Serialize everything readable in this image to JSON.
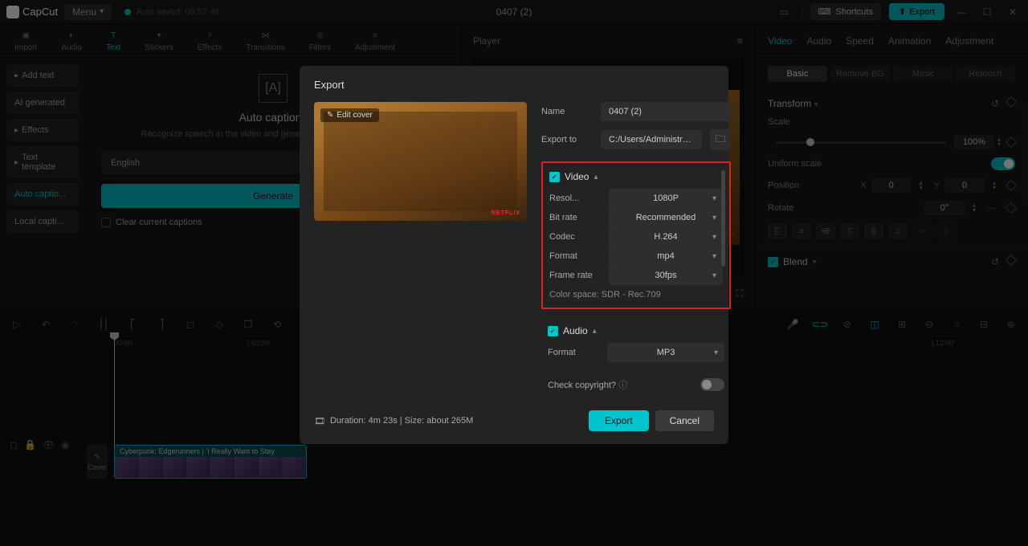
{
  "app": {
    "name": "CapCut",
    "menu": "Menu",
    "autosave": "Auto saved: 09:57:48",
    "title": "0407 (2)",
    "shortcuts": "Shortcuts",
    "export": "Export"
  },
  "tools": {
    "import": "Import",
    "audio": "Audio",
    "text": "Text",
    "stickers": "Stickers",
    "effects": "Effects",
    "transitions": "Transitions",
    "filters": "Filters",
    "adjustment": "Adjustment"
  },
  "sidebar": {
    "add_text": "Add text",
    "ai_generated": "AI generated",
    "effects": "Effects",
    "text_template": "Text template",
    "auto_captions": "Auto captio...",
    "local_captions": "Local capti..."
  },
  "auto_caption": {
    "title": "Auto captions",
    "desc": "Recognize speech in the video and generate captions automatically",
    "language": "English",
    "generate": "Generate",
    "clear": "Clear current captions"
  },
  "player": {
    "label": "Player",
    "netflix": "NETFLIX"
  },
  "right": {
    "tabs": {
      "video": "Video",
      "audio": "Audio",
      "speed": "Speed",
      "animation": "Animation",
      "adjustment": "Adjustment"
    },
    "subtabs": {
      "basic": "Basic",
      "remove_bg": "Remove BG",
      "mask": "Mask",
      "retouch": "Retouch"
    },
    "transform": "Transform",
    "scale": "Scale",
    "scale_value": "100%",
    "uniform": "Uniform scale",
    "position": "Position",
    "x": "X",
    "x_val": "0",
    "y": "Y",
    "y_val": "0",
    "rotate": "Rotate",
    "rotate_val": "0°",
    "blend": "Blend"
  },
  "timeline": {
    "t0": "00:00",
    "t2": "| 02:00",
    "t12": "| 12:00",
    "clip_title": "Cyberpunk:   Edgerunners   |    'I Really Want to Stay",
    "cover": "Cover"
  },
  "modal": {
    "title": "Export",
    "edit_cover": "Edit cover",
    "name_label": "Name",
    "name_value": "0407 (2)",
    "export_to_label": "Export to",
    "export_to_value": "C:/Users/Administrat...",
    "video_label": "Video",
    "resolution_label": "Resol...",
    "resolution_value": "1080P",
    "bitrate_label": "Bit rate",
    "bitrate_value": "Recommended",
    "codec_label": "Codec",
    "codec_value": "H.264",
    "format_label": "Format",
    "format_value": "mp4",
    "framerate_label": "Frame rate",
    "framerate_value": "30fps",
    "color_space": "Color space: SDR - Rec.709",
    "audio_label": "Audio",
    "audio_format_label": "Format",
    "audio_format_value": "MP3",
    "copyright": "Check copyright?",
    "duration": "Duration: 4m 23s | Size: about 265M",
    "export_btn": "Export",
    "cancel_btn": "Cancel",
    "netflix": "NETFLIX"
  }
}
